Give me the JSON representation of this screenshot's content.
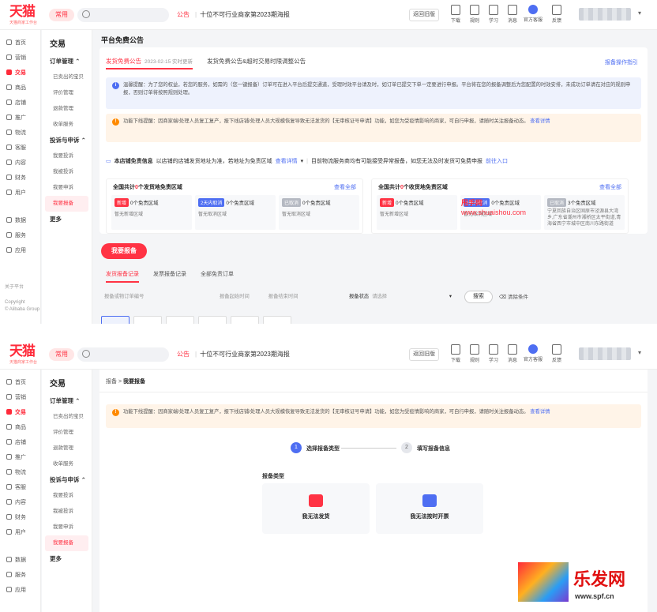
{
  "topbar": {
    "logo": "天猫",
    "logo_sub": "天猫商家工作台",
    "common_label": "常用",
    "notice_tag": "公告",
    "notice_text": "十位不可行业商家第2023期海报",
    "old_version": "返回旧版",
    "tools": [
      {
        "label": "下载",
        "icon": "download-icon"
      },
      {
        "label": "规则",
        "icon": "rules-icon"
      },
      {
        "label": "学习",
        "icon": "learn-icon"
      },
      {
        "label": "消息",
        "icon": "message-icon"
      },
      {
        "label": "官方客服",
        "icon": "service-icon"
      },
      {
        "label": "反馈",
        "icon": "feedback-icon"
      }
    ]
  },
  "rail": {
    "items": [
      "首页",
      "营销",
      "交易",
      "商品",
      "店铺",
      "推广",
      "物流",
      "客服",
      "内容",
      "财务",
      "用户"
    ],
    "items_bottom": [
      "数据",
      "服务",
      "应用"
    ],
    "footer": [
      "关于平台",
      "Copyright",
      "© Alibaba Group"
    ]
  },
  "sub": {
    "title": "交易",
    "groups": [
      {
        "label": "订单管理 ⌃",
        "items": [
          "已卖出的宝贝",
          "评价管理",
          "退款管理",
          "收单服务"
        ]
      },
      {
        "label": "投诉与申诉 ⌃",
        "items": [
          "我要投诉",
          "我被投诉",
          "我要申诉",
          "我要报备"
        ]
      }
    ],
    "more": "更多",
    "active": "我要报备"
  },
  "screen1": {
    "page_title": "平台免费公告",
    "tabs": [
      {
        "label": "发货免费公告",
        "time": "2023-02-15 实时更新"
      },
      {
        "label": "发货免费公告&超时交易时限调整公告"
      }
    ],
    "guide": "报备操作指引",
    "banner1": "温馨提醒：为了您的权益，若您的服务，如需的（您一键报备）订单可在进入平台后提交通道，受理时效平台请及时，如订单已提交下单一定要进行申报。平台将在您的报备调整后为您配置的时效安排，未成功订单请在对应的规则申报，否则订单将按照规则处理。",
    "banner2": "功能下线提醒：因商家端/处理人员复工复产，报下线店铺/处理人员大规模恢复导致无法发货的【无审核证号申请】功能，如您为受疫情影响的商家，可自行申报，请随时关注报备动态。",
    "banner2_link": "查看详情",
    "info_prefix": "本店铺免责信息",
    "info_text": "以店铺的店铺发货地址为准，若地址为免责区域",
    "info_link": "查看详情",
    "info_tail": "目前物流服务商均有可能接受异常报备，如您无法及时发货可免费申报",
    "info_link2": "前往入口",
    "panel_left": {
      "prefix": "全国共计",
      "count": "0",
      "suffix": "个发货地免责区域",
      "more": "查看全部"
    },
    "panel_right": {
      "prefix": "全国共计",
      "count": "0",
      "suffix": "个收货地免责区域",
      "more": "查看全部"
    },
    "zones_left": [
      {
        "tag": "新增",
        "text": "0个免责区域",
        "detail": "暂无新增区域",
        "color": "#ff3344"
      },
      {
        "tag": "2天内取消",
        "text": "0个免责区域",
        "detail": "暂无取消区域",
        "color": "#4e6ef2"
      },
      {
        "tag": "已取消",
        "text": "0个免责区域",
        "detail": "暂无取消区域",
        "color": "#b5b9c2"
      }
    ],
    "zones_right": [
      {
        "tag": "新增",
        "text": "0个免责区域",
        "detail": "暂无新增区域",
        "color": "#ff3344"
      },
      {
        "tag": "2天内取消",
        "text": "0个免责区域",
        "detail": "暂无取消区域",
        "color": "#4e6ef2"
      },
      {
        "tag": "已取消",
        "text": "3个免责区域",
        "detail": "宁夏回族自治区固原市泾源县大湾乡,广东省潮州市湘桥区太平街道,青海省西宁市城中区南川东路街道",
        "color": "#b5b9c2"
      }
    ],
    "report_button": "我要报备",
    "record_tabs": [
      "发货报备记录",
      "发票报备记录",
      "全部免责订单"
    ],
    "filter_order": "报备或物订单编号",
    "filter_time_start": "报备起始时间",
    "filter_time_end": "报备结束时间",
    "filter_status_label": "报备状态",
    "filter_status_value": "请选择",
    "search_button": "搜索",
    "clear_button": "清除条件",
    "watermark_name": "甩手网",
    "watermark_url": "www.shuaishou.com"
  },
  "screen2": {
    "breadcrumb_root": "报备",
    "breadcrumb_current": "我要报备",
    "banner": "功能下线提醒：因商家端/处理人员复工复产，报下线店铺/处理人员大规模恢复导致无法发货的【无审核证号申请】功能，如您为受疫情影响的商家，可自行申报，请随时关注报备动态。",
    "banner_link": "查看详情",
    "step1": "选择报备类型",
    "step2": "填写报备信息",
    "type_label": "报备类型",
    "type_cards": [
      "我无法发货",
      "我无法按时开票"
    ],
    "logo_text": "乐发网",
    "logo_url": "www.spf.cn"
  }
}
